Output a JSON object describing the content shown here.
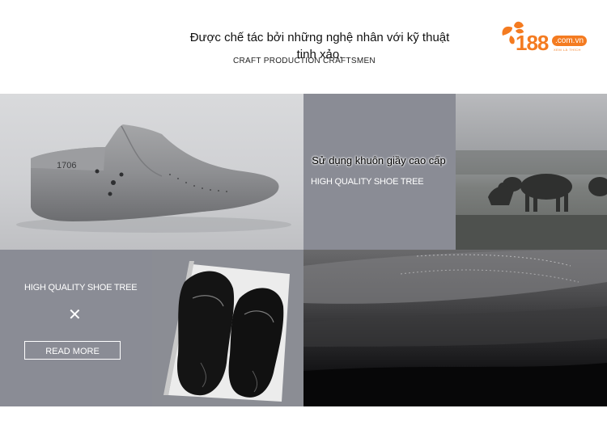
{
  "header": {
    "title": "Được chế tác bởi những nghệ nhân với kỹ thuật tinh xảo.",
    "subtitle": "CRAFT PRODUCTION CRAFTSMEN"
  },
  "logo": {
    "number": "188",
    "domain": ".com.vn",
    "tagline": "XEM LÀ THÍCH",
    "color": "#f47b20"
  },
  "shoe_last_image": {
    "number": "1706"
  },
  "panel_mid": {
    "title": "Sử dụng khuôn giầy cao cấp",
    "subtitle": "HIGH QUALITY SHOE TREE"
  },
  "panel_left": {
    "subtitle": "HIGH QUALITY SHOE TREE",
    "divider_symbol": "✕",
    "button_label": "READ MORE"
  },
  "colors": {
    "panel_gray": "#8a8c95",
    "text_white": "#ffffff"
  }
}
